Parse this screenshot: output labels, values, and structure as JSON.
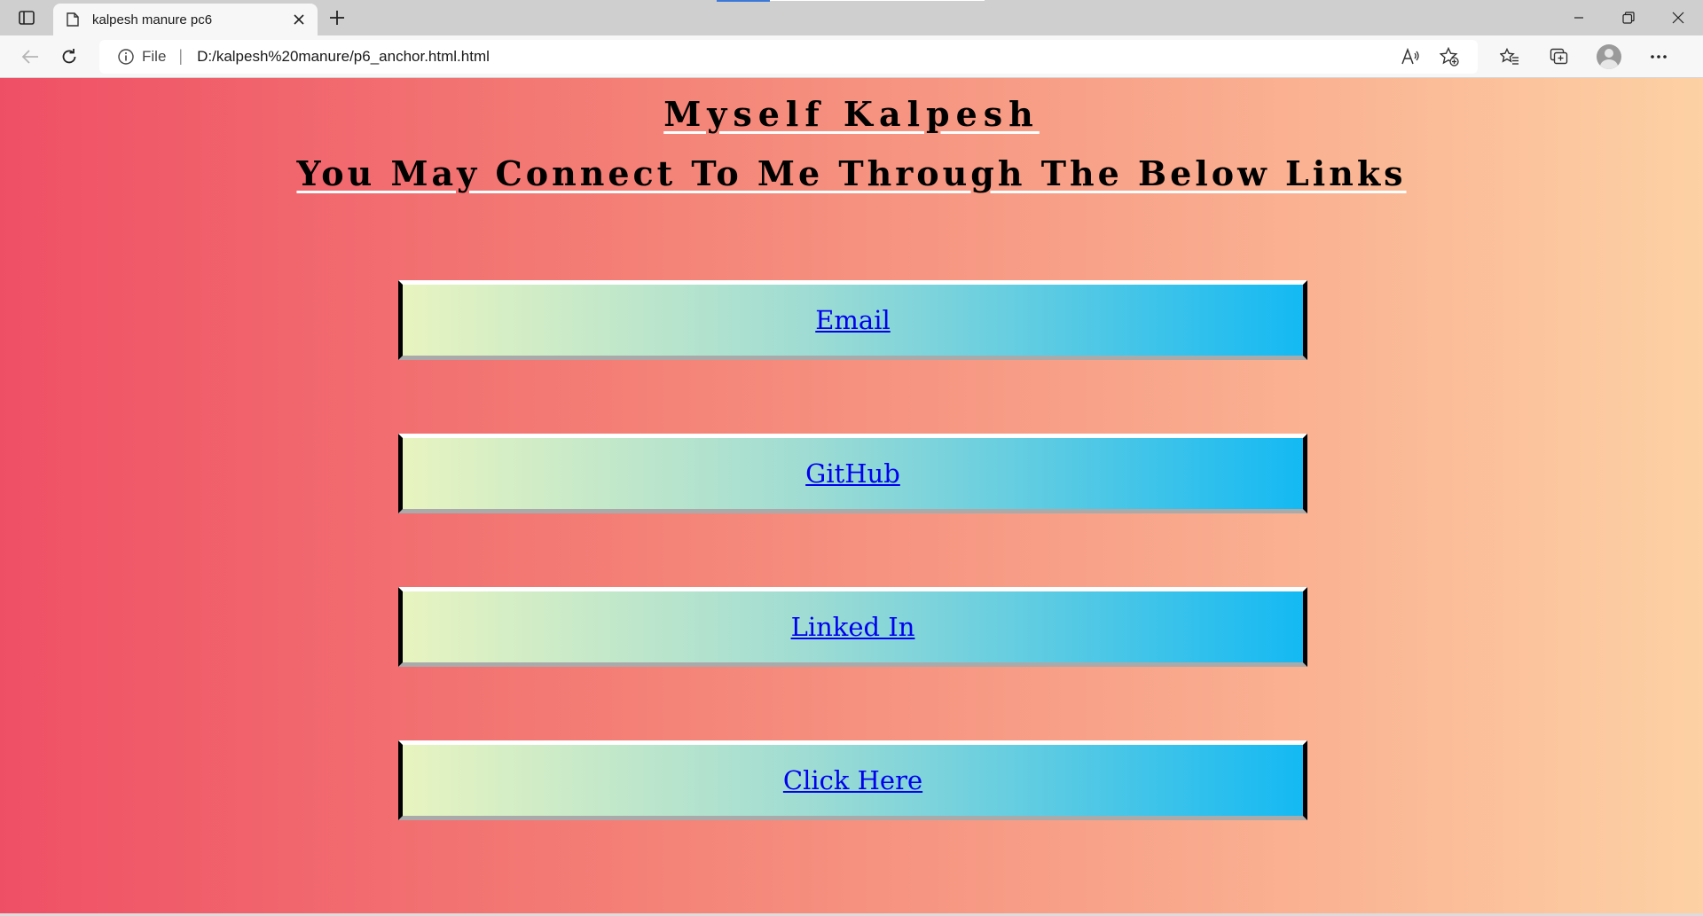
{
  "browser": {
    "tab": {
      "title": "kalpesh manure pc6",
      "close_glyph": "✕"
    },
    "new_tab_glyph": "+",
    "address": {
      "scheme": "File",
      "separator": "|",
      "url": "D:/kalpesh%20manure/p6_anchor.html.html"
    },
    "icons": {
      "tab_actions": "tab-actions-icon",
      "page": "page-icon",
      "back": "back-arrow-icon",
      "refresh": "refresh-icon",
      "info": "info-icon",
      "read_aloud": "read-aloud-icon",
      "add_favorite": "add-favorite-icon",
      "favorites": "favorites-icon",
      "collections": "collections-icon",
      "profile": "profile-avatar",
      "more": "more-icon",
      "minimize": "minimize-icon",
      "restore": "restore-icon",
      "close": "close-window-icon"
    }
  },
  "page": {
    "title": "Myself Kalpesh",
    "subtitle": "You May Connect To Me Through The Below Links",
    "links": [
      {
        "label": "Email"
      },
      {
        "label": "GitHub"
      },
      {
        "label": "Linked In"
      },
      {
        "label": "Click Here"
      }
    ]
  },
  "colors": {
    "page_gradient_start": "#ef4f65",
    "page_gradient_end": "#fdd1a4",
    "link_box_gradient_start": "#e8f4c0",
    "link_box_gradient_end": "#14b9f3",
    "link_text": "#0000ee"
  }
}
